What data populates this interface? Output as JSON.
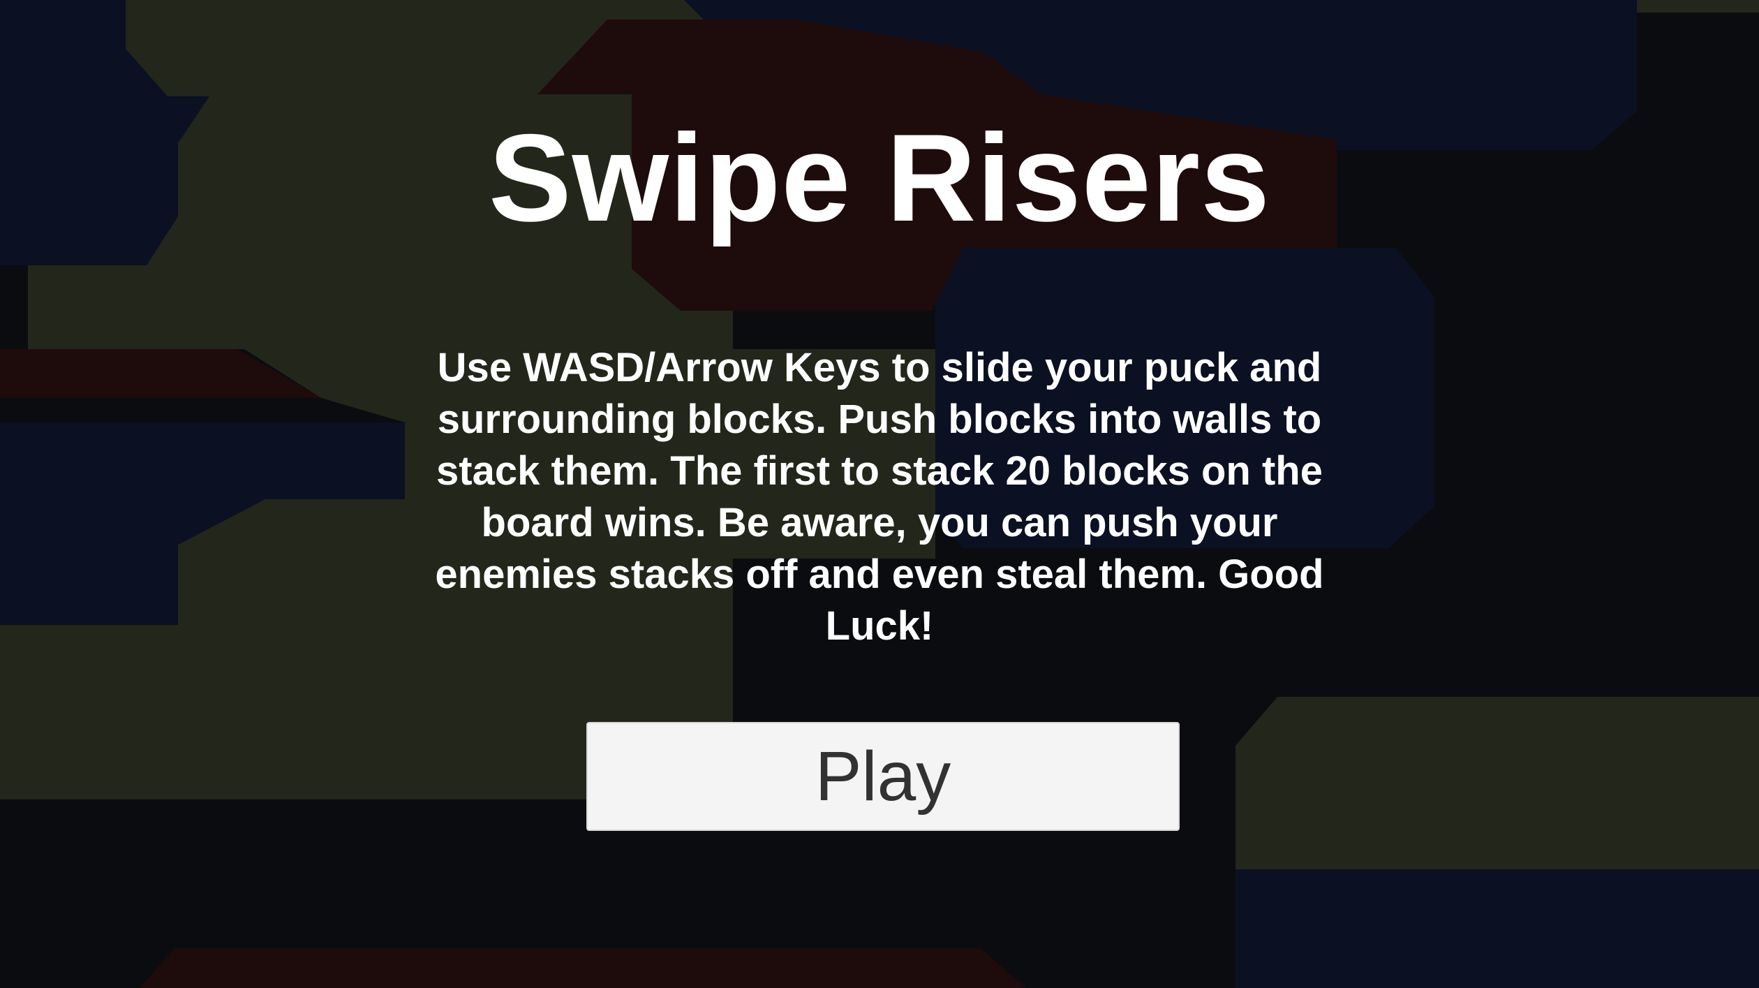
{
  "title": "Swipe Risers",
  "instructions": "Use WASD/Arrow Keys to slide your puck and surrounding blocks. Push blocks into walls to stack them. The first to stack 20 blocks on the board wins. Be aware, you can push your enemies stacks off and even steal them. Good Luck!",
  "play_button": {
    "label": "Play"
  },
  "colors": {
    "background": "#0b0c10",
    "olive_block": "#23261b",
    "navy_block": "#0b1022",
    "maroon_block": "#1e0b0c",
    "text": "#ffffff",
    "button_bg": "#f4f4f4",
    "button_text": "#323232"
  }
}
